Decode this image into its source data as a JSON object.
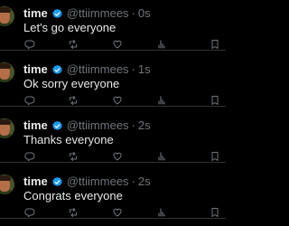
{
  "colors": {
    "background": "#000000",
    "text_primary": "#e7e9ea",
    "text_secondary": "#71767b",
    "verified_badge": "#1d9bf0",
    "divider": "#2f3336"
  },
  "icons": {
    "verified": "verified-badge-icon",
    "reply": "reply-icon",
    "repost": "repost-icon",
    "like": "heart-icon",
    "views": "views-icon",
    "bookmark": "bookmark-icon",
    "share": "share-icon"
  },
  "tweets": [
    {
      "name": "time",
      "handle": "@ttiimmees",
      "separator": "·",
      "time": "0s",
      "text": "Let's go everyone"
    },
    {
      "name": "time",
      "handle": "@ttiimmees",
      "separator": "·",
      "time": "1s",
      "text": "Ok sorry everyone"
    },
    {
      "name": "time",
      "handle": "@ttiimmees",
      "separator": "·",
      "time": "2s",
      "text": "Thanks everyone"
    },
    {
      "name": "time",
      "handle": "@ttiimmees",
      "separator": "·",
      "time": "2s",
      "text": "Congrats everyone"
    }
  ]
}
